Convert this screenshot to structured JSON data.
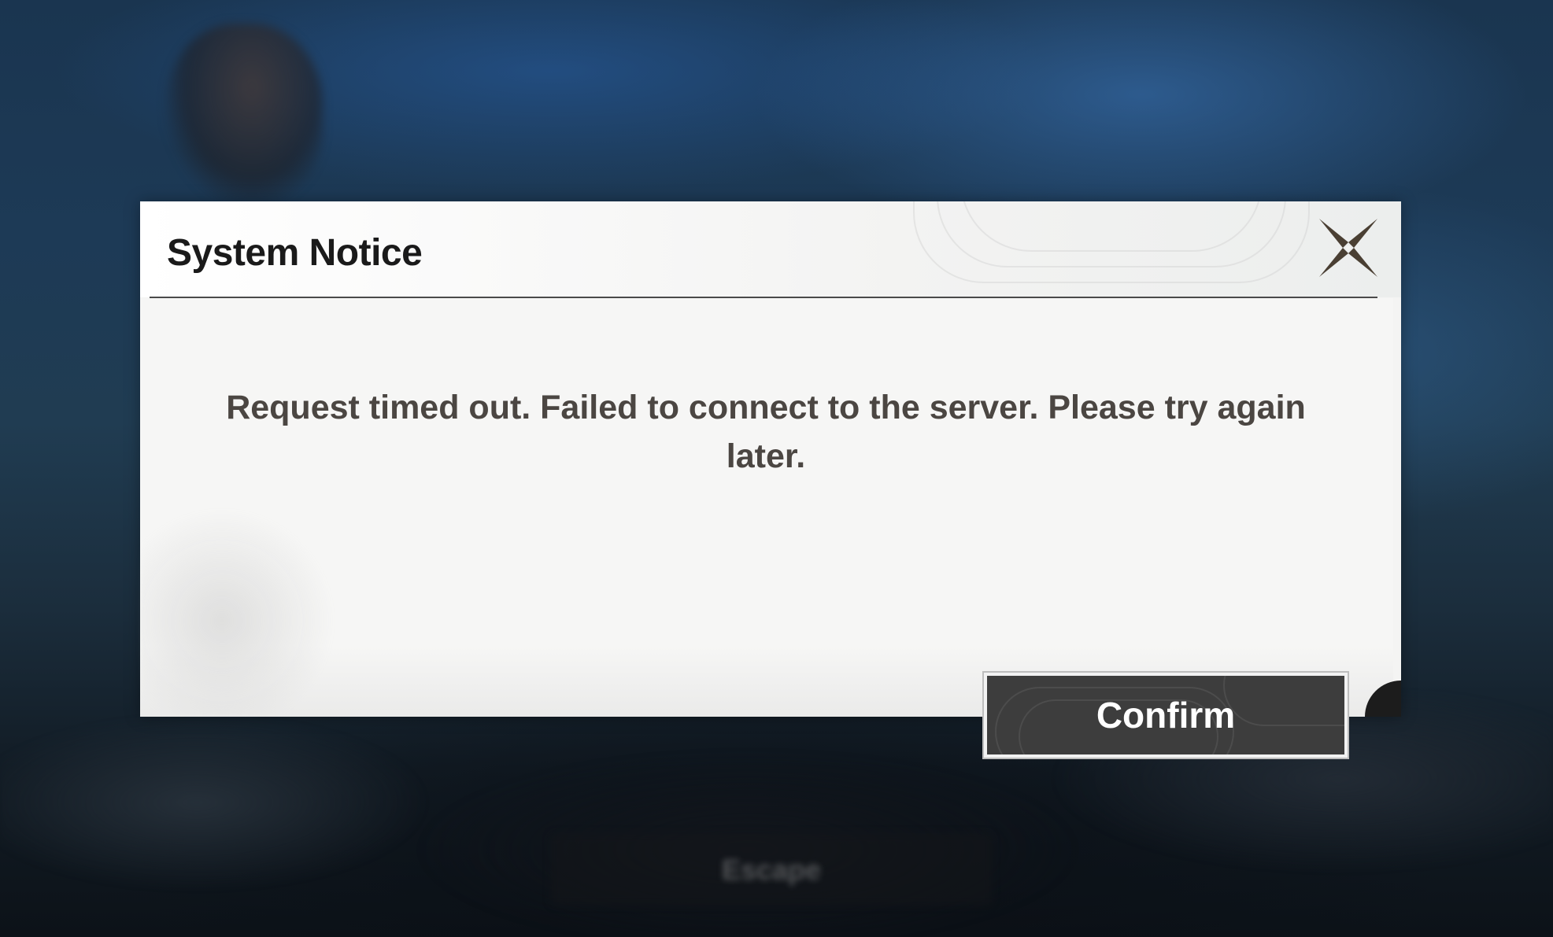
{
  "dialog": {
    "title": "System Notice",
    "message": "Request timed out. Failed to connect to the server. Please try again later.",
    "confirm_label": "Confirm",
    "close_icon": "close-icon"
  },
  "background": {
    "button_label": "Escape"
  },
  "colors": {
    "dialog_bg": "#f4f4f3",
    "title_text": "#1a1a1a",
    "message_text": "#4b4642",
    "button_bg": "#3d3d3d",
    "button_text": "#ffffff",
    "close_icon": "#4a3f33",
    "frame_accent": "#1c1c1c"
  }
}
